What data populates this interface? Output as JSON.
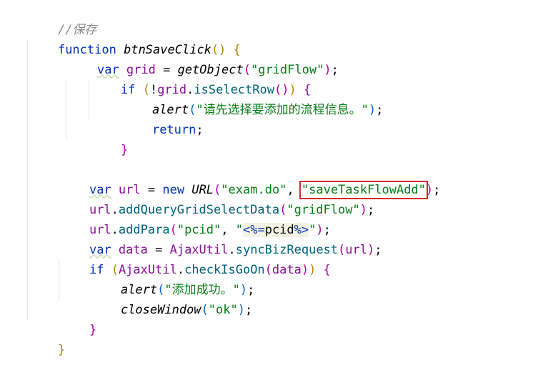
{
  "code": {
    "comment": "//保存",
    "function_kw": "function",
    "function_name": "btnSaveClick",
    "var_kw": "var",
    "if_kw": "if",
    "return_kw": "return",
    "new_kw": "new",
    "grid_var": "grid",
    "url_var": "url",
    "data_var": "data",
    "getObject_fn": "getObject",
    "gridFlow_str": "\"gridFlow\"",
    "isSelectRow_fn": "isSelectRow",
    "alert_fn": "alert",
    "alert_msg1": "\"请先选择要添加的流程信息。\"",
    "URL_cls": "URL",
    "exam_str": "\"exam.do\"",
    "saveTaskFlowAdd_str": "\"saveTaskFlowAdd\"",
    "addQueryGridSelectData_fn": "addQueryGridSelectData",
    "addPara_fn": "addPara",
    "pcid_str": "\"pcid\"",
    "jsp_open": "<%=",
    "pcid_expr": "pcid",
    "jsp_close": "%>",
    "AjaxUtil_cls": "AjaxUtil",
    "syncBizRequest_fn": "syncBizRequest",
    "checkIsGoOn_fn": "checkIsGoOn",
    "alert_msg2": "\"添加成功。\"",
    "closeWindow_fn": "closeWindow",
    "ok_str": "\"ok\""
  },
  "colors": {
    "keyword": "#0033b3",
    "string": "#067d17",
    "variable": "#871094",
    "comment": "#8c8c8c",
    "highlight_box": "#d52a2a"
  }
}
